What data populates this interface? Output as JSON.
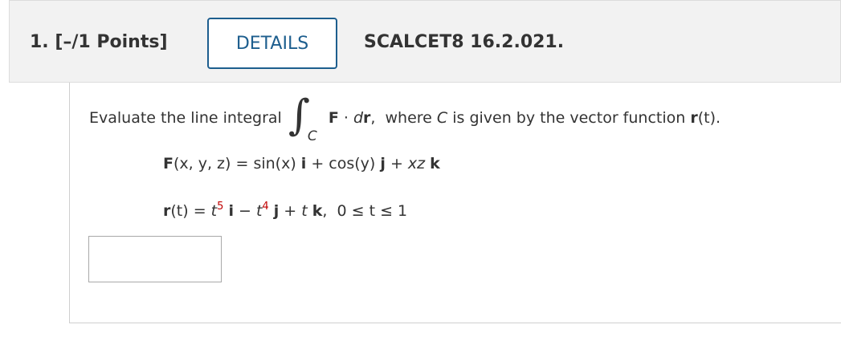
{
  "header": {
    "question_number": "1.",
    "points": "[–/1 Points]",
    "details_label": "DETAILS",
    "problem_code": "SCALCET8 16.2.021."
  },
  "problem": {
    "prompt_prefix": "Evaluate the line integral",
    "integral_symbol": "∫",
    "integral_subscript": "C",
    "integrand_F": "F",
    "dot": " · ",
    "integrand_dr": "dr",
    "prompt_middle": ",  where ",
    "curve_var": "C",
    "prompt_suffix": " is given by the vector function ",
    "r_bold": "r",
    "r_arg": "(t)",
    "period": ".",
    "F_eq": {
      "lhs_bold": "F",
      "lhs_args": "(x, y, z)",
      "equals": " = ",
      "term1": "sin(x) ",
      "i": "i",
      "plus1": " + ",
      "term2": "cos(y) ",
      "j": "j",
      "plus2": " + ",
      "term3": "xz ",
      "k": "k"
    },
    "r_eq": {
      "lhs_bold": "r",
      "lhs_args": "(t)",
      "equals": " = ",
      "t1": "t",
      "exp1": "5",
      "i": "i",
      "minus": " − ",
      "t2": "t",
      "exp2": "4",
      "j": "j",
      "plus": " + ",
      "t3": "t ",
      "k": "k",
      "domain": ",  0 ≤ t ≤ 1"
    }
  },
  "answer": {
    "value": ""
  },
  "colors": {
    "accent": "#1d5e8e",
    "highlight": "#c00000"
  }
}
